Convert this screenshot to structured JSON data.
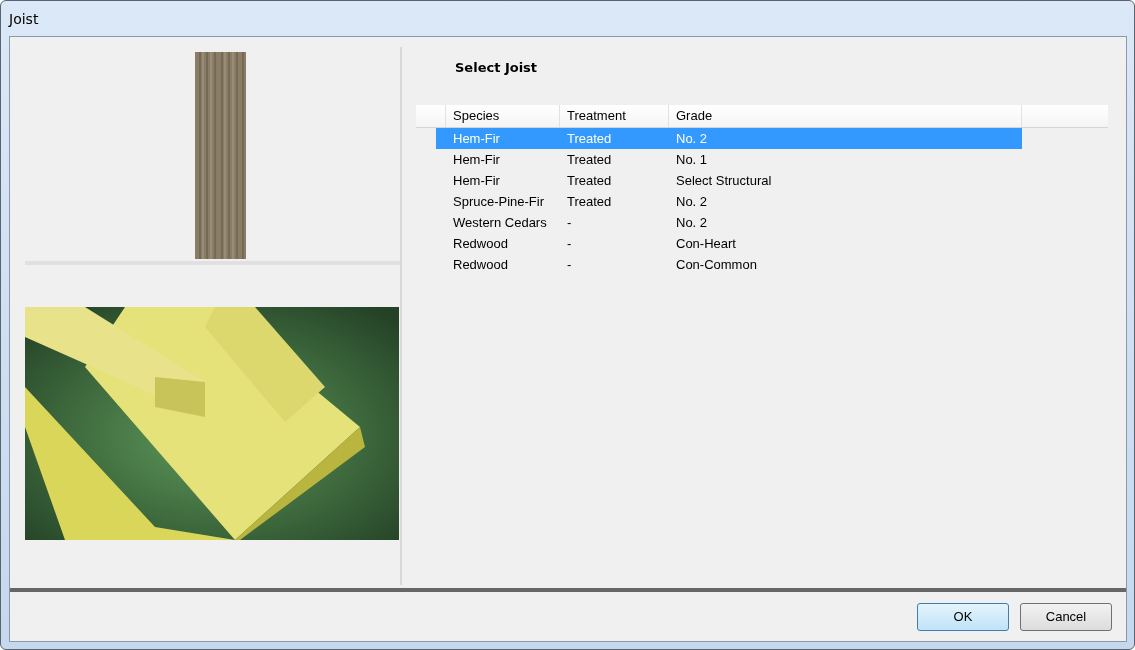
{
  "window": {
    "title": "Joist"
  },
  "heading": "Select Joist",
  "table": {
    "columns": [
      "Species",
      "Treatment",
      "Grade"
    ],
    "rows": [
      {
        "cells": [
          "Hem-Fir",
          "Treated",
          "No. 2"
        ],
        "selected": true
      },
      {
        "cells": [
          "Hem-Fir",
          "Treated",
          "No. 1"
        ],
        "selected": false
      },
      {
        "cells": [
          "Hem-Fir",
          "Treated",
          "Select Structural"
        ],
        "selected": false
      },
      {
        "cells": [
          "Spruce-Pine-Fir",
          "Treated",
          "No. 2"
        ],
        "selected": false
      },
      {
        "cells": [
          "Western Cedars",
          "-",
          "No. 2"
        ],
        "selected": false
      },
      {
        "cells": [
          "Redwood",
          "-",
          "Con-Heart"
        ],
        "selected": false
      },
      {
        "cells": [
          "Redwood",
          "-",
          "Con-Common"
        ],
        "selected": false
      }
    ]
  },
  "buttons": [
    {
      "label": "OK",
      "default": true
    },
    {
      "label": "Cancel",
      "default": false
    }
  ]
}
